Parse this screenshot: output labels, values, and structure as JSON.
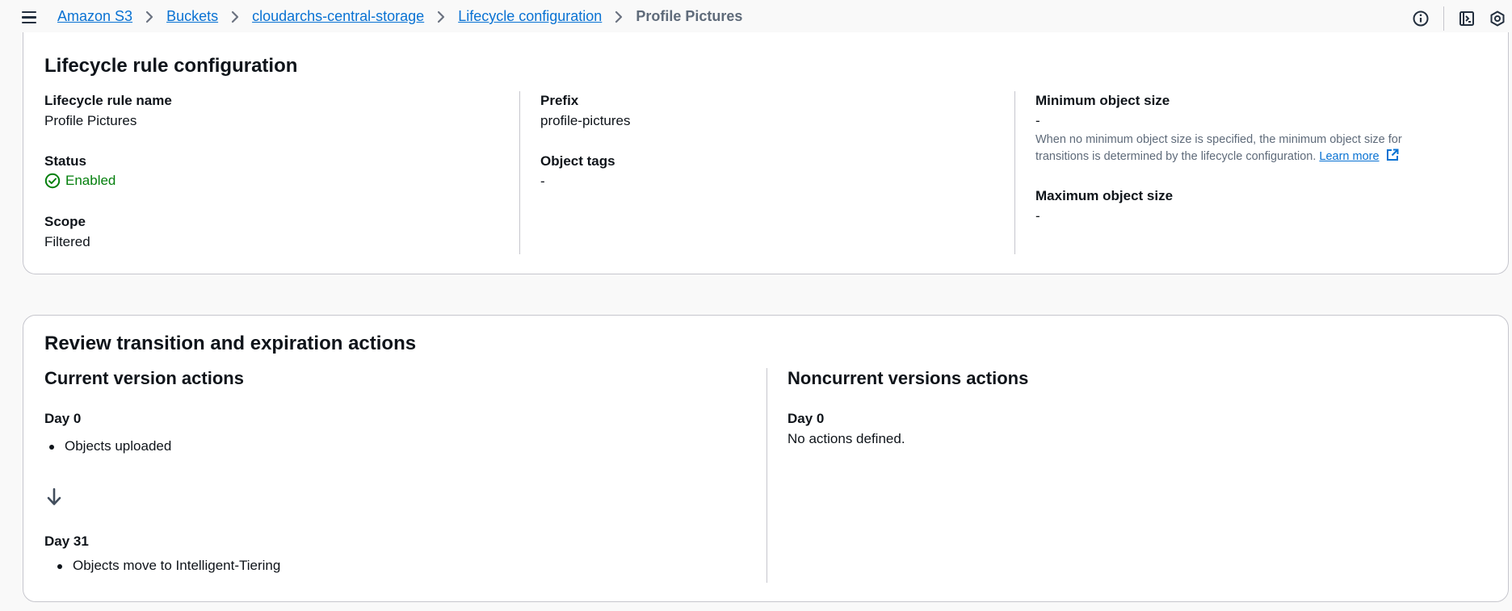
{
  "breadcrumb": {
    "items": [
      "Amazon S3",
      "Buckets",
      "cloudarchs-central-storage",
      "Lifecycle configuration"
    ],
    "current": "Profile Pictures"
  },
  "icons": {
    "menu": "hamburger-menu-icon",
    "info": "info-icon",
    "panel": "side-panel-icon",
    "settings": "hexagon-settings-icon",
    "status": "check-circle-icon",
    "external": "external-link-icon",
    "arrow": "arrow-down-icon"
  },
  "colors": {
    "link": "#0972d3",
    "success": "#037f0c"
  },
  "rule_config": {
    "title": "Lifecycle rule configuration",
    "name_label": "Lifecycle rule name",
    "name_value": "Profile Pictures",
    "status_label": "Status",
    "status_value": "Enabled",
    "scope_label": "Scope",
    "scope_value": "Filtered",
    "prefix_label": "Prefix",
    "prefix_value": "profile-pictures",
    "tags_label": "Object tags",
    "tags_value": "-",
    "min_size_label": "Minimum object size",
    "min_size_value": "-",
    "min_size_note": "When no minimum object size is specified, the minimum object size for transitions is determined by the lifecycle configuration.",
    "learn_more": "Learn more",
    "max_size_label": "Maximum object size",
    "max_size_value": "-"
  },
  "review": {
    "title": "Review transition and expiration actions",
    "current": {
      "heading": "Current version actions",
      "day0_label": "Day 0",
      "day0_items": [
        "Objects uploaded"
      ],
      "day31_label": "Day 31",
      "day31_items": [
        "Objects move to Intelligent-Tiering"
      ]
    },
    "noncurrent": {
      "heading": "Noncurrent versions actions",
      "day0_label": "Day 0",
      "day0_text": "No actions defined."
    }
  }
}
